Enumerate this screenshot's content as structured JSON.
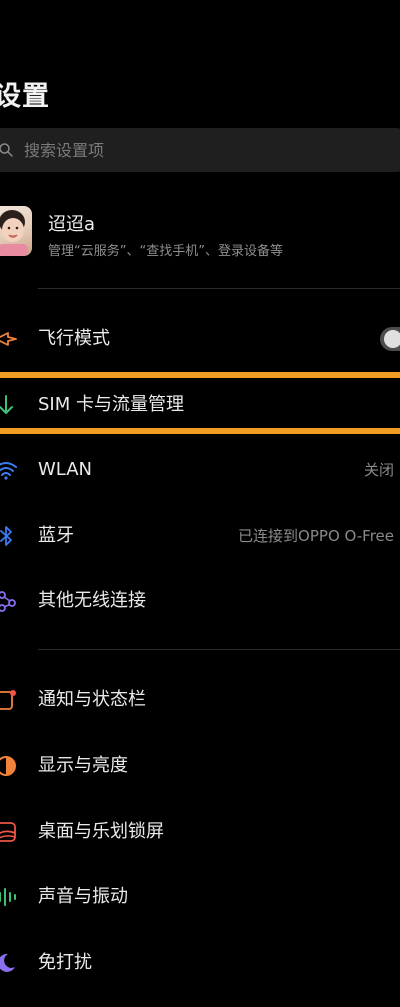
{
  "header": {
    "title": "设置"
  },
  "search": {
    "placeholder": "搜索设置项"
  },
  "profile": {
    "name": "迢迢a",
    "subtitle": "管理“云服务”、“查找手机”、登录设备等"
  },
  "network": {
    "airplane": {
      "label": "飞行模式",
      "icon": "airplane-icon",
      "toggle_on": false
    },
    "sim": {
      "label": "SIM 卡与流量管理",
      "icon": "sim-data-icon",
      "highlight_color": "#f39c22"
    },
    "wlan": {
      "label": "WLAN",
      "value": "关闭",
      "icon": "wifi-icon"
    },
    "bluetooth": {
      "label": "蓝牙",
      "value": "已连接到OPPO O-Free",
      "icon": "bluetooth-icon"
    },
    "other": {
      "label": "其他无线连接",
      "icon": "connection-icon"
    }
  },
  "display": {
    "notification": {
      "label": "通知与状态栏",
      "icon": "notification-icon"
    },
    "brightness": {
      "label": "显示与亮度",
      "icon": "brightness-icon"
    },
    "desktop": {
      "label": "桌面与乐划锁屏",
      "icon": "wallpaper-icon"
    },
    "sound": {
      "label": "声音与振动",
      "icon": "sound-icon"
    },
    "dnd": {
      "label": "免打扰",
      "icon": "moon-icon"
    }
  },
  "colors": {
    "accent_orange": "#f39c22",
    "icon_orange": "#f0823a",
    "icon_green": "#3fc07a",
    "icon_blue": "#3d7cf0",
    "icon_red": "#f05545",
    "icon_purple": "#8a6ff0"
  }
}
